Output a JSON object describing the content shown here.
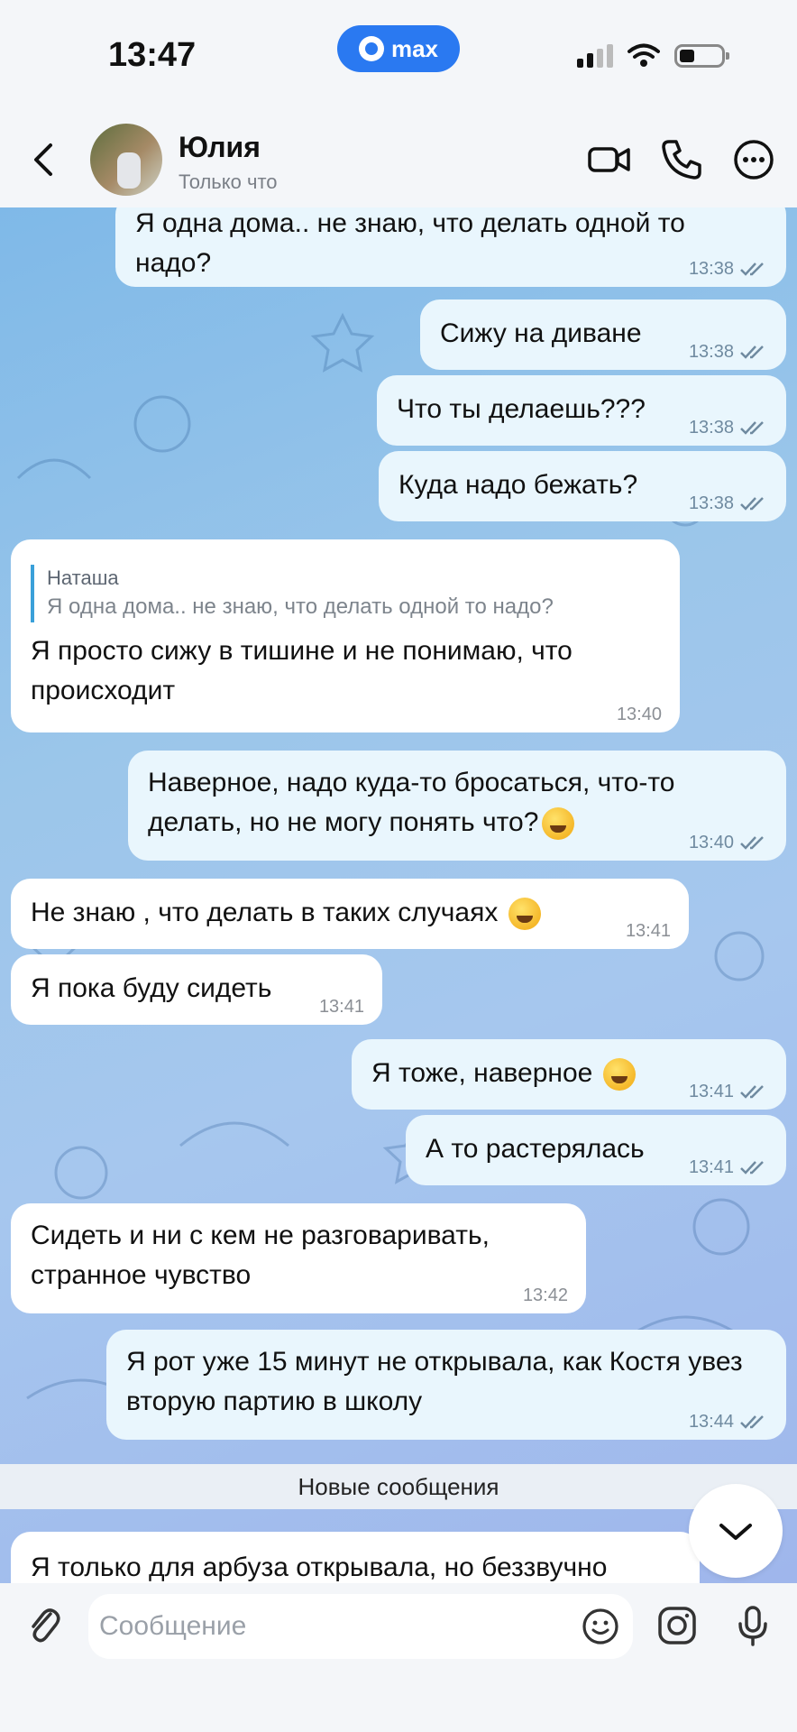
{
  "status_bar": {
    "time": "13:47",
    "app_pill": "max"
  },
  "header": {
    "name": "Юлия",
    "status": "Только что"
  },
  "messages": [
    {
      "text": "Я одна дома.. не знаю, что делать одной то надо?",
      "time": "13:38"
    },
    {
      "text": "Сижу на диване",
      "time": "13:38"
    },
    {
      "text": "Что ты делаешь???",
      "time": "13:38"
    },
    {
      "text": "Куда надо бежать?",
      "time": "13:38"
    },
    {
      "reply_name": "Наташа",
      "reply_text": "Я одна дома.. не знаю, что делать одной то надо?",
      "text": "Я просто сижу в тишине и не понимаю, что происходит",
      "time": "13:40"
    },
    {
      "text": "Наверное, надо куда-то бросаться, что-то делать, но не могу понять что?",
      "time": "13:40"
    },
    {
      "text": "Не знаю , что делать в таких случаях",
      "time": "13:41"
    },
    {
      "text": "Я пока буду сидеть",
      "time": "13:41"
    },
    {
      "text": "Я тоже, наверное",
      "time": "13:41"
    },
    {
      "text": "А то растерялась",
      "time": "13:41"
    },
    {
      "text": "Сидеть и ни с кем не разговаривать, странное чувство",
      "time": "13:42"
    },
    {
      "text": "Я рот уже 15 минут не открывала, как Костя увез вторую партию в школу",
      "time": "13:44"
    },
    {
      "text": "Я только для арбуза открывала, но беззвучно"
    }
  ],
  "new_messages_label": "Новые сообщения",
  "input": {
    "placeholder": "Сообщение"
  }
}
